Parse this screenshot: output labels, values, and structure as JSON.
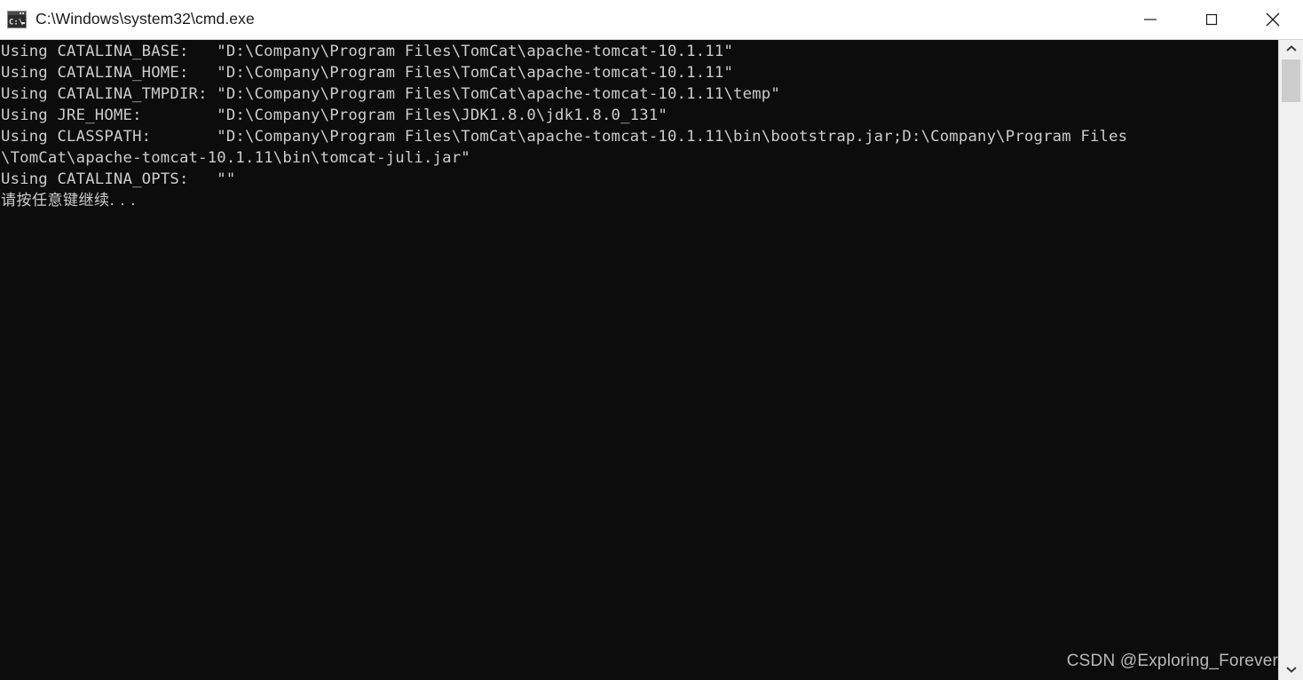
{
  "window": {
    "title": "C:\\Windows\\system32\\cmd.exe",
    "icon": "cmd-console-icon",
    "titlebar_bg": "#ffffff",
    "title_color": "#1a1a1a",
    "controls": [
      {
        "name": "minimize",
        "label": "Minimize",
        "glyph": "minimize-icon"
      },
      {
        "name": "maximize",
        "label": "Maximize",
        "glyph": "maximize-icon"
      },
      {
        "name": "close",
        "label": "Close",
        "glyph": "close-icon"
      }
    ]
  },
  "terminal": {
    "background": "#0c0c0c",
    "foreground": "#cccccc",
    "lines": [
      "Using CATALINA_BASE:   \"D:\\Company\\Program Files\\TomCat\\apache-tomcat-10.1.11\"",
      "Using CATALINA_HOME:   \"D:\\Company\\Program Files\\TomCat\\apache-tomcat-10.1.11\"",
      "Using CATALINA_TMPDIR: \"D:\\Company\\Program Files\\TomCat\\apache-tomcat-10.1.11\\temp\"",
      "Using JRE_HOME:        \"D:\\Company\\Program Files\\JDK1.8.0\\jdk1.8.0_131\"",
      "Using CLASSPATH:       \"D:\\Company\\Program Files\\TomCat\\apache-tomcat-10.1.11\\bin\\bootstrap.jar;D:\\Company\\Program Files",
      "\\TomCat\\apache-tomcat-10.1.11\\bin\\tomcat-juli.jar\"",
      "Using CATALINA_OPTS:   \"\"",
      "请按任意键继续. . ."
    ]
  },
  "watermark": {
    "text": "CSDN @Exploring_Forever",
    "color": "#b9b9b9"
  },
  "scrollbar": {
    "up_arrow": "chevron-up-icon",
    "down_arrow": "chevron-down-icon",
    "track_color": "#f0f0f0",
    "thumb_color": "#cdcdcd"
  }
}
